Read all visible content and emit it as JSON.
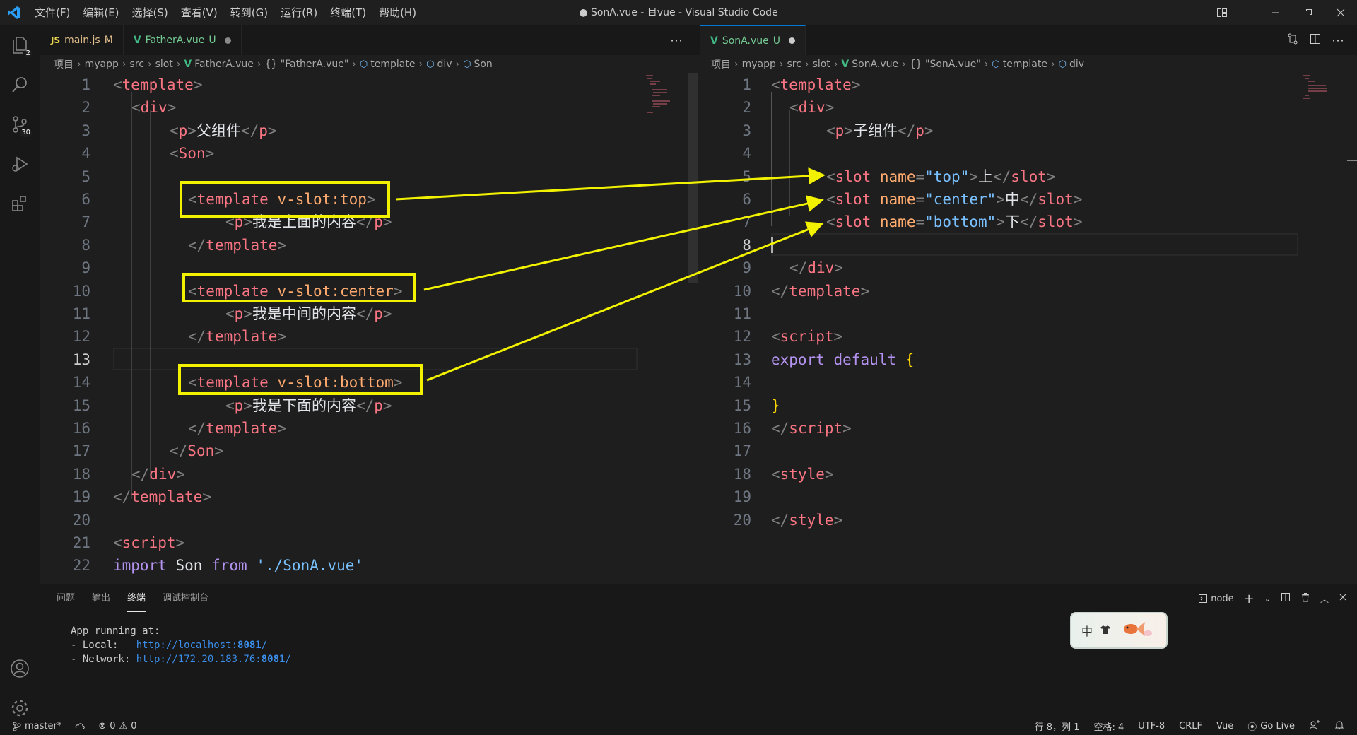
{
  "titlebar": {
    "menu": [
      "文件(F)",
      "编辑(E)",
      "选择(S)",
      "查看(V)",
      "转到(G)",
      "运行(R)",
      "终端(T)",
      "帮助(H)"
    ],
    "title": "● SonA.vue - 目vue - Visual Studio Code"
  },
  "activity": {
    "explorer_badge": "2",
    "scm_badge": "30"
  },
  "left_editor": {
    "tabs": [
      {
        "label": "main.js",
        "prefix": "JS",
        "status": "M"
      },
      {
        "label": "FatherA.vue",
        "prefix": "V",
        "status": "U"
      }
    ],
    "breadcrumb": [
      "项目",
      "myapp",
      "src",
      "slot",
      "FatherA.vue",
      "{} \"FatherA.vue\"",
      "template",
      "div",
      "Son"
    ],
    "line_numbers": [
      "1",
      "2",
      "3",
      "4",
      "5",
      "6",
      "7",
      "8",
      "9",
      "10",
      "11",
      "12",
      "13",
      "14",
      "15",
      "16",
      "17",
      "18",
      "19",
      "20",
      "21",
      "22"
    ],
    "code": {
      "l1": "template",
      "l2": "div",
      "l3_tag": "p",
      "l3_text": "父组件",
      "l4": "Son",
      "l6_tag": "template",
      "l6_attr": "v-slot:top",
      "l7_tag": "p",
      "l7_text": "我是上面的内容",
      "l8": "template",
      "l10_tag": "template",
      "l10_attr": "v-slot:center",
      "l11_tag": "p",
      "l11_text": "我是中间的内容",
      "l12": "template",
      "l14_tag": "template",
      "l14_attr": "v-slot:bottom",
      "l15_tag": "p",
      "l15_text": "我是下面的内容",
      "l16": "template",
      "l17": "Son",
      "l18": "div",
      "l19": "template",
      "l21": "script",
      "l22_kw": "import",
      "l22_name": "Son",
      "l22_from": "from",
      "l22_str": "'./SonA.vue'"
    }
  },
  "right_editor": {
    "tab": {
      "label": "SonA.vue",
      "prefix": "V",
      "status": "U"
    },
    "breadcrumb": [
      "项目",
      "myapp",
      "src",
      "slot",
      "SonA.vue",
      "{} \"SonA.vue\"",
      "template",
      "div"
    ],
    "line_numbers": [
      "1",
      "2",
      "3",
      "4",
      "5",
      "6",
      "7",
      "8",
      "9",
      "10",
      "11",
      "12",
      "13",
      "14",
      "15",
      "16",
      "17",
      "18",
      "19",
      "20"
    ],
    "code": {
      "l1": "template",
      "l2": "div",
      "l3_tag": "p",
      "l3_text": "子组件",
      "l5_attrname": "name",
      "l5_val": "\"top\"",
      "l5_text": "上",
      "l6_attrname": "name",
      "l6_val": "\"center\"",
      "l6_text": "中",
      "l7_attrname": "name",
      "l7_val": "\"bottom\"",
      "l7_text": "下",
      "slot_tag": "slot",
      "l9": "div",
      "l10": "template",
      "l12": "script",
      "l13_kw": "export",
      "l13_kw2": "default",
      "l13_br": "{",
      "l15_br": "}",
      "l16": "script",
      "l18": "style",
      "l20": "style"
    }
  },
  "panel": {
    "tabs": [
      "问题",
      "输出",
      "终端",
      "调试控制台"
    ],
    "active_tab": "终端",
    "shell": "node",
    "terminal": {
      "line1": "App running at:",
      "local_label": "- Local:   ",
      "local_url": "http://localhost:",
      "local_port": "8081",
      "network_label": "- Network: ",
      "network_url": "http://172.20.183.76:",
      "network_port": "8081",
      "slash": "/"
    },
    "ime_label": "中"
  },
  "statusbar": {
    "branch": "master*",
    "errors": "0",
    "warnings": "0",
    "position": "行 8，列 1",
    "spaces": "空格: 4",
    "encoding": "UTF-8",
    "eol": "CRLF",
    "language": "Vue",
    "golive": "Go Live"
  },
  "colors": {
    "highlight": "#f2f200",
    "accent": "#0078d4"
  }
}
